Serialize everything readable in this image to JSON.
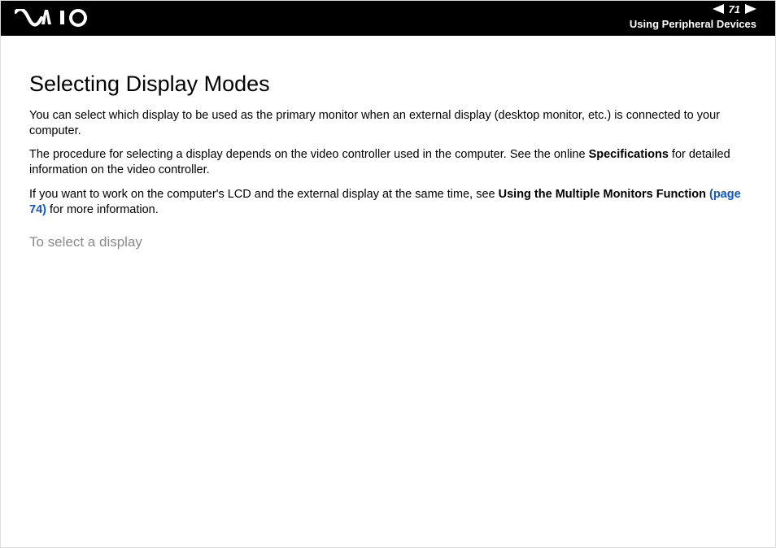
{
  "header": {
    "page_number": "71",
    "section": "Using Peripheral Devices"
  },
  "content": {
    "heading": "Selecting Display Modes",
    "p1": "You can select which display to be used as the primary monitor when an external display (desktop monitor, etc.) is connected to your computer.",
    "p2_a": "The procedure for selecting a display depends on the video controller used in the computer. See the online ",
    "p2_bold": "Specifications",
    "p2_b": " for detailed information on the video controller.",
    "p3_a": "If you want to work on the computer's LCD and the external display at the same time, see ",
    "p3_bold": "Using the Multiple Monitors Function",
    "p3_link": " (page 74)",
    "p3_b": " for more information.",
    "subheading": "To select a display"
  }
}
